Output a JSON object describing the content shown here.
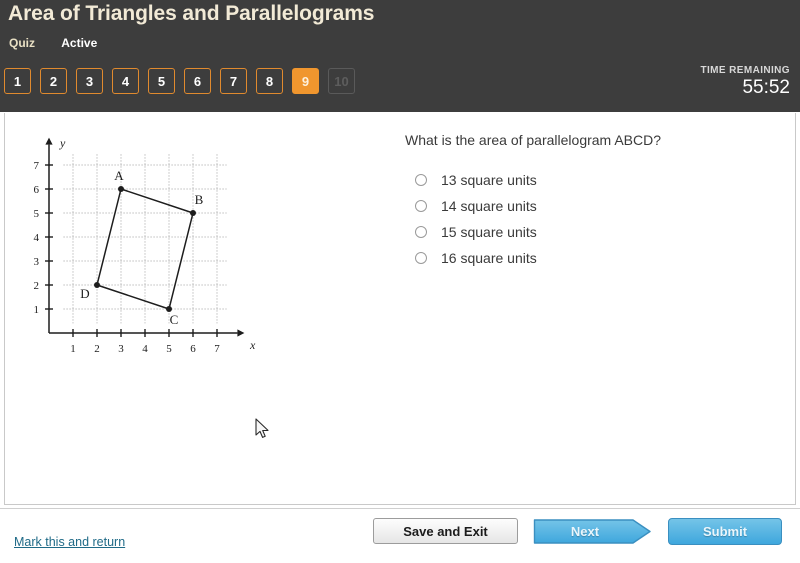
{
  "header": {
    "title": "Area of Triangles and Parallelograms",
    "kind": "Quiz",
    "status": "Active",
    "accent_color": "#f0962e",
    "background_color": "#3d3d3d"
  },
  "question_nav": {
    "items": [
      {
        "label": "1",
        "state": "available"
      },
      {
        "label": "2",
        "state": "available"
      },
      {
        "label": "3",
        "state": "available"
      },
      {
        "label": "4",
        "state": "available"
      },
      {
        "label": "5",
        "state": "available"
      },
      {
        "label": "6",
        "state": "available"
      },
      {
        "label": "7",
        "state": "available"
      },
      {
        "label": "8",
        "state": "available"
      },
      {
        "label": "9",
        "state": "current"
      },
      {
        "label": "10",
        "state": "disabled"
      }
    ]
  },
  "timer": {
    "label": "TIME REMAINING",
    "value": "55:52"
  },
  "question": {
    "prompt": "What is the area of parallelogram ABCD?",
    "choices": [
      {
        "label": "13 square units",
        "selected": false
      },
      {
        "label": "14 square units",
        "selected": false
      },
      {
        "label": "15 square units",
        "selected": false
      },
      {
        "label": "16 square units",
        "selected": false
      }
    ]
  },
  "chart_data": {
    "type": "scatter",
    "title": "",
    "xlabel": "x",
    "ylabel": "y",
    "xlim": [
      0,
      7.6
    ],
    "ylim": [
      0,
      7.6
    ],
    "xticks": [
      "1",
      "2",
      "3",
      "4",
      "5",
      "6",
      "7"
    ],
    "yticks": [
      "1",
      "2",
      "3",
      "4",
      "5",
      "6",
      "7"
    ],
    "grid": true,
    "legend": "none",
    "annotations": [
      "A",
      "B",
      "C",
      "D"
    ],
    "series": [
      {
        "name": "parallelogram ABCD",
        "closed": true,
        "points": [
          {
            "label": "A",
            "x": 3,
            "y": 6
          },
          {
            "label": "B",
            "x": 6,
            "y": 5
          },
          {
            "label": "C",
            "x": 5,
            "y": 1
          },
          {
            "label": "D",
            "x": 2,
            "y": 2
          }
        ]
      }
    ]
  },
  "footer": {
    "mark_link": "Mark this and return",
    "save_label": "Save and Exit",
    "next_label": "Next",
    "submit_label": "Submit"
  }
}
